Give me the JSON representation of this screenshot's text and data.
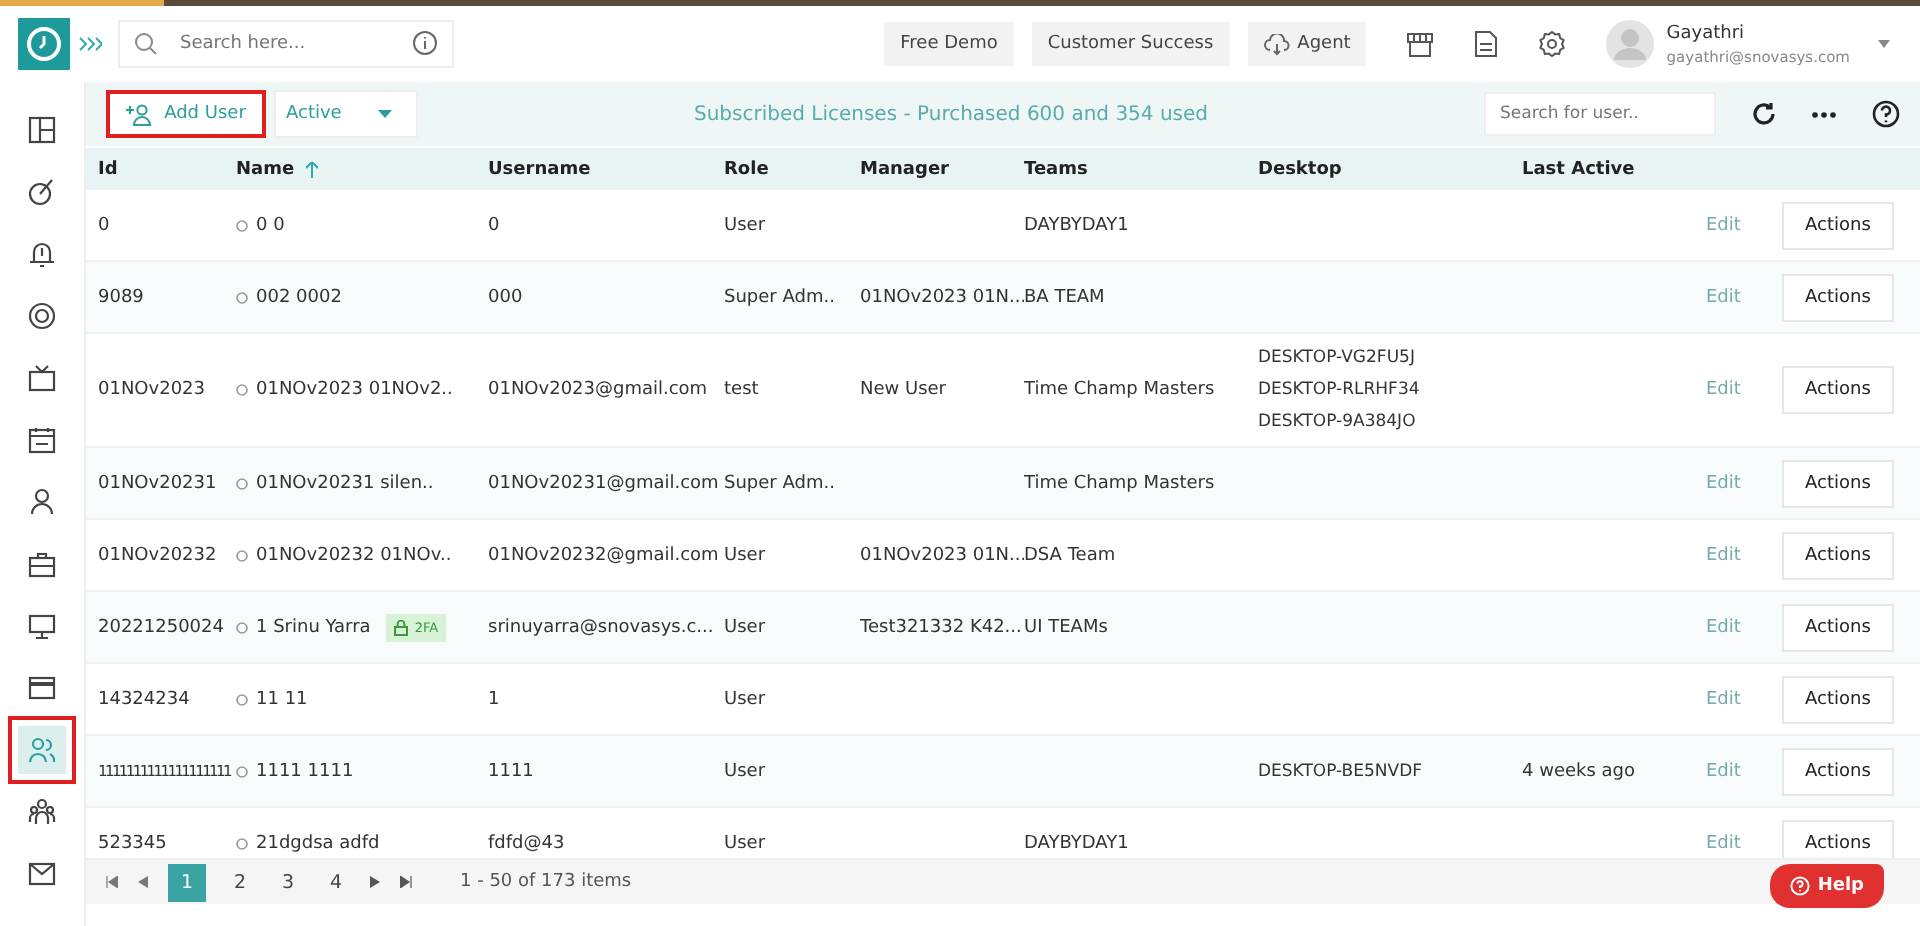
{
  "topbar": {
    "search_placeholder": "Search here...",
    "buttons": [
      "Free Demo",
      "Customer Success",
      "Agent"
    ],
    "user": {
      "name": "Gayathri",
      "email": "gayathri@snovasys.com"
    }
  },
  "sidebar": {
    "items": [
      {
        "selected": false
      },
      {
        "selected": false
      },
      {
        "selected": false
      },
      {
        "selected": false
      },
      {
        "selected": false
      },
      {
        "selected": false
      },
      {
        "selected": false
      },
      {
        "selected": false
      },
      {
        "selected": false
      },
      {
        "selected": false
      },
      {
        "selected": true,
        "highlighted": true
      },
      {
        "selected": false
      },
      {
        "selected": false
      }
    ]
  },
  "toolbar": {
    "add_user": {
      "label": "Add User",
      "highlighted": true
    },
    "status_filter": "Active",
    "license_text": "Subscribed Licenses - Purchased 600 and 354 used",
    "search_placeholder": "Search for user.."
  },
  "table": {
    "columns": [
      "Id",
      "Name",
      "Username",
      "Role",
      "Manager",
      "Teams",
      "Desktop",
      "Last Active"
    ],
    "rows": [
      {
        "id": "0",
        "name": "0 0",
        "username": "0",
        "role": "User",
        "teams": "DAYBYDAY1",
        "edit": "Edit",
        "actions": "Actions"
      },
      {
        "id": "9089",
        "name": "002 0002",
        "username": "000",
        "role": "Super Adm..",
        "manager": "01NOv2023 01N...",
        "teams": "BA TEAM",
        "edit": "Edit",
        "actions": "Actions"
      },
      {
        "id": "01NOv2023",
        "name": "01NOv2023 01NOv2..",
        "username": "01NOv2023@gmail.com",
        "role": "test",
        "manager": "New User",
        "teams": "Time Champ Masters",
        "desktops": [
          "DESKTOP-VG2FU5J",
          "DESKTOP-RLRHF34",
          "DESKTOP-9A384JO"
        ],
        "edit": "Edit",
        "actions": "Actions"
      },
      {
        "id": "01NOv20231",
        "name": "01NOv20231 silen..",
        "username": "01NOv20231@gmail.com",
        "role": "Super Adm..",
        "teams": "Time Champ Masters",
        "edit": "Edit",
        "actions": "Actions"
      },
      {
        "id": "01NOv20232",
        "name": "01NOv20232 01NOv..",
        "username": "01NOv20232@gmail.com",
        "role": "User",
        "manager": "01NOv2023 01N...",
        "teams": "DSA Team",
        "edit": "Edit",
        "actions": "Actions"
      },
      {
        "id": "20221250024",
        "name": "1 Srinu Yarra",
        "badge": "2FA",
        "username": "srinuyarra@snovasys.c...",
        "role": "User",
        "manager": "Test321332 K42...",
        "teams": "UI TEAMs",
        "edit": "Edit",
        "actions": "Actions"
      },
      {
        "id": "14324234",
        "name": "11 11",
        "username": "1",
        "role": "User",
        "edit": "Edit",
        "actions": "Actions"
      },
      {
        "id": "1111111111111111111",
        "name": "1111 1111",
        "username": "1111",
        "role": "User",
        "desktops": [
          "DESKTOP-BE5NVDF"
        ],
        "last_active": "4 weeks ago",
        "edit": "Edit",
        "actions": "Actions"
      },
      {
        "id": "523345",
        "name": "21dgdsa adfd",
        "username": "fdfd@43",
        "role": "User",
        "teams": "DAYBYDAY1",
        "edit": "Edit",
        "actions": "Actions"
      }
    ]
  },
  "pagination": {
    "pages": [
      {
        "label": "1",
        "selected": true
      },
      {
        "label": "2",
        "selected": false
      },
      {
        "label": "3",
        "selected": false
      },
      {
        "label": "4",
        "selected": false
      }
    ],
    "summary": "1 - 50 of 173 items"
  },
  "help_button": "Help"
}
